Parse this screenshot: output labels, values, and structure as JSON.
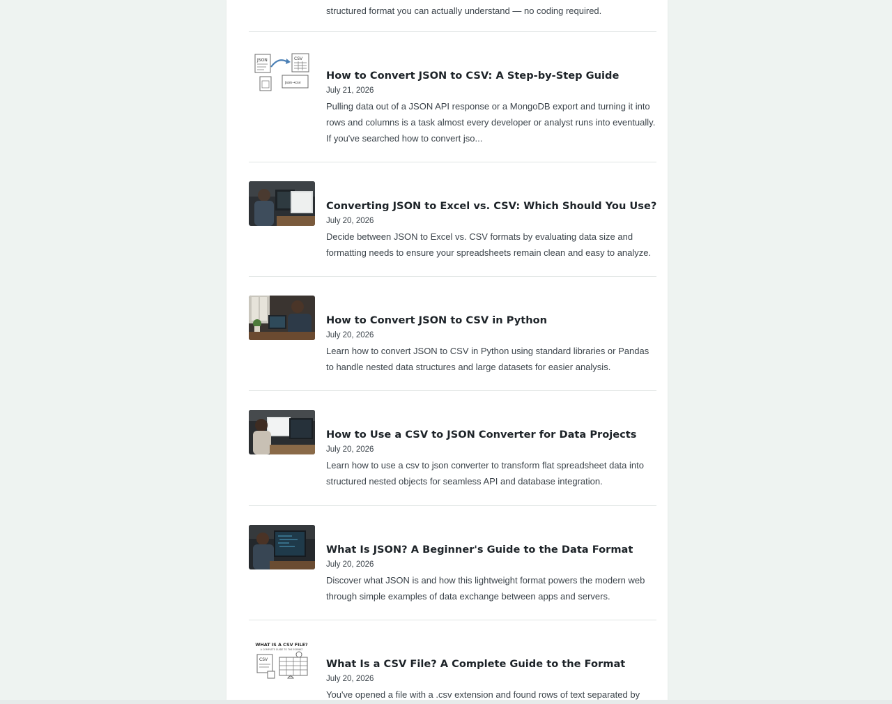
{
  "top_snippet": "structured format you can actually understand — no coding required.",
  "posts": [
    {
      "title": "How to Convert JSON to CSV: A Step-by-Step Guide",
      "date": "July 21, 2026",
      "excerpt": "Pulling data out of a JSON API response or a MongoDB export and turning it into rows and columns is a task almost every developer or analyst runs into eventually. If you've searched how to convert jso...",
      "thumb_text": {
        "json": "JSON",
        "csv": "CSV",
        "cmd": "json→csv"
      }
    },
    {
      "title": "Converting JSON to Excel vs. CSV: Which Should You Use?",
      "date": "July 20, 2026",
      "excerpt": "Decide between JSON to Excel vs. CSV formats by evaluating data size and formatting needs to ensure your spreadsheets remain clean and easy to analyze."
    },
    {
      "title": "How to Convert JSON to CSV in Python",
      "date": "July 20, 2026",
      "excerpt": "Learn how to convert JSON to CSV in Python using standard libraries or Pandas to handle nested data structures and large datasets for easier analysis."
    },
    {
      "title": "How to Use a CSV to JSON Converter for Data Projects",
      "date": "July 20, 2026",
      "excerpt": "Learn how to use a csv to json converter to transform flat spreadsheet data into structured nested objects for seamless API and database integration."
    },
    {
      "title": "What Is JSON? A Beginner's Guide to the Data Format",
      "date": "July 20, 2026",
      "excerpt": "Discover what JSON is and how this lightweight format powers the modern web through simple examples of data exchange between apps and servers."
    },
    {
      "title": "What Is a CSV File? A Complete Guide to the Format",
      "date": "July 20, 2026",
      "excerpt": "You've opened a file with a .csv extension and found rows of text separated by",
      "thumb_text": {
        "heading": "WHAT IS A CSV FILE?",
        "subheading": "A COMPLETE GUIDE TO THE FORMAT",
        "csv": "CSV"
      }
    }
  ],
  "colors": {
    "background": "#eef3f1",
    "card": "#ffffff",
    "title": "#1d2328",
    "body_text": "#3b434a",
    "divider": "#dfe4e3"
  }
}
